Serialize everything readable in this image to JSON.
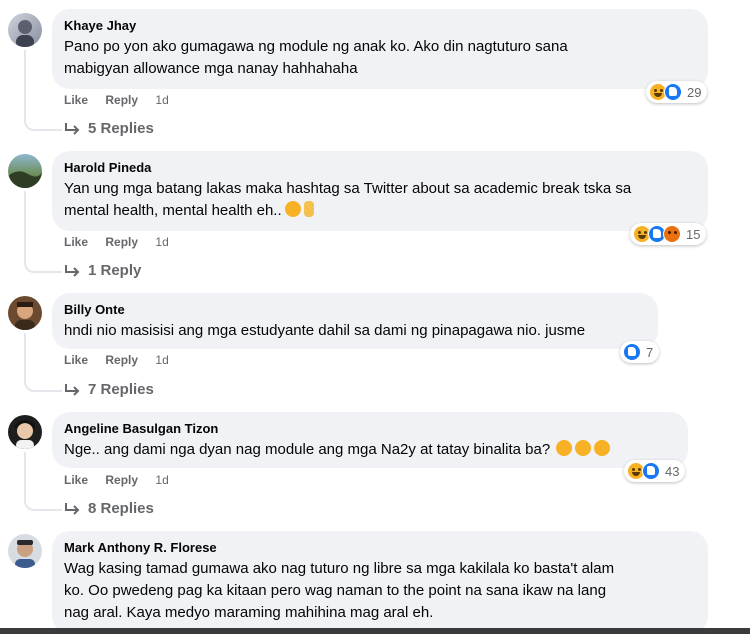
{
  "colors": {
    "bubble": "#f0f2f5",
    "meta": "#65676b",
    "like": "#1877f2",
    "haha": "#f7b125",
    "angry": "#e9710f"
  },
  "comments": [
    {
      "author": "Khaye Jhay",
      "text": "Pano po yon ako gumagawa ng module ng anak ko. Ako din nagtuturo sana\nmabigyan allowance mga nanay hahhahaha",
      "like": "Like",
      "reply": "Reply",
      "time": "1d",
      "reaction_count": "29",
      "reaction_icons": [
        "haha-icon",
        "like-icon"
      ],
      "replies": "5 Replies"
    },
    {
      "author": "Harold Pineda",
      "text": "Yan ung mga batang lakas maka hashtag sa Twitter about sa academic break tska sa\nmental health, mental health eh..",
      "like": "Like",
      "reply": "Reply",
      "time": "1d",
      "reaction_count": "15",
      "reaction_icons": [
        "haha-icon",
        "like-icon",
        "angry-icon"
      ],
      "replies": "1 Reply"
    },
    {
      "author": "Billy Onte",
      "text": "hndi nio masisisi ang mga estudyante dahil sa dami ng pinapagawa nio. jusme",
      "like": "Like",
      "reply": "Reply",
      "time": "1d",
      "reaction_count": "7",
      "reaction_icons": [
        "like-icon"
      ],
      "replies": "7 Replies"
    },
    {
      "author": "Angeline Basulgan Tizon",
      "text": "Nge.. ang dami nga dyan nag module ang mga Na2y at tatay binalita ba?",
      "like": "Like",
      "reply": "Reply",
      "time": "1d",
      "reaction_count": "43",
      "reaction_icons": [
        "haha-icon",
        "like-icon"
      ],
      "replies": "8 Replies"
    },
    {
      "author": "Mark Anthony R. Florese",
      "text": "Wag kasing tamad gumawa ako nag tuturo ng libre sa mga kakilala ko basta't alam\nko. Oo pwedeng pag ka kitaan pero wag naman to the point na sana ikaw na lang\nnag aral. Kaya medyo maraming mahihina mag aral eh."
    }
  ]
}
